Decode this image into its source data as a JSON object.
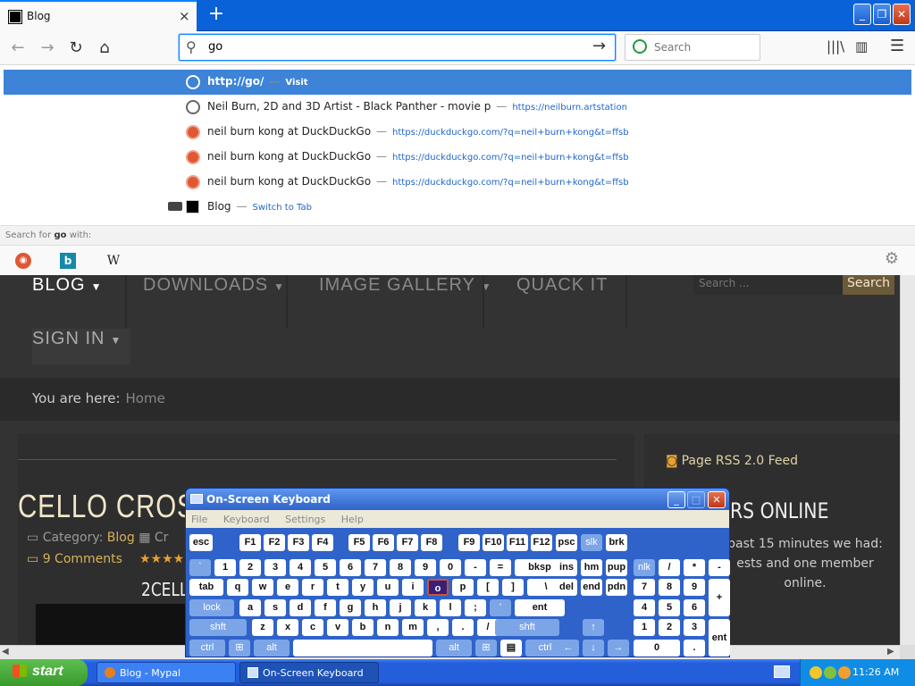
{
  "browser": {
    "tab_title": "Blog",
    "tab_close": "×",
    "new_tab": "+",
    "url_value": "go",
    "search_placeholder": "Search"
  },
  "dropdown": {
    "rows": [
      {
        "title": "http://go/",
        "action": "Visit"
      },
      {
        "title": "Neil Burn, 2D and 3D Artist - Black Panther - movie p",
        "url": "https://neilburn.artstation"
      },
      {
        "title": "neil burn kong at DuckDuckGo",
        "url": "https://duckduckgo.com/?q=neil+burn+kong&t=ffsb"
      },
      {
        "title": "neil burn kong at DuckDuckGo",
        "url": "https://duckduckgo.com/?q=neil+burn+kong&t=ffsb"
      },
      {
        "title": "neil burn kong at DuckDuckGo",
        "url": "https://duckduckgo.com/?q=neil+burn+kong&t=ffsb"
      },
      {
        "title": "Blog",
        "action": "Switch to Tab"
      }
    ],
    "search_for_prefix": "Search for",
    "search_for_term": "go",
    "search_for_suffix": "with:",
    "engines": {
      "bing": "b",
      "wiki": "W"
    }
  },
  "webpage": {
    "menu": {
      "blog": "BLOG",
      "downloads": "DOWNLOADS",
      "gallery": "IMAGE GALLERY",
      "quack": "QUACK IT",
      "signin": "SIGN IN"
    },
    "search_placeholder": "Search ...",
    "search_button": "Search",
    "breadcrumb_label": "You are here:",
    "breadcrumb_home": "Home",
    "post_title": "CELLO CROSSO",
    "category_label": "Category:",
    "category_value": "Blog",
    "category_tail": "Cr",
    "comments": "9 Comments",
    "stars": "★★★★",
    "subtitle": "2CELL",
    "rss": "Page RSS 2.0 Feed",
    "online_heading": "RS ONLINE",
    "online_text": "past 15 minutes we had: ests and one member online."
  },
  "osk": {
    "title": "On-Screen Keyboard",
    "menu": [
      "File",
      "Keyboard",
      "Settings",
      "Help"
    ],
    "minimize": "_",
    "maximize": "□",
    "close": "✕"
  },
  "taskbar": {
    "start": "start",
    "task1": "Blog - Mypal",
    "task2": "On-Screen Keyboard",
    "clock": "11:26 AM"
  }
}
